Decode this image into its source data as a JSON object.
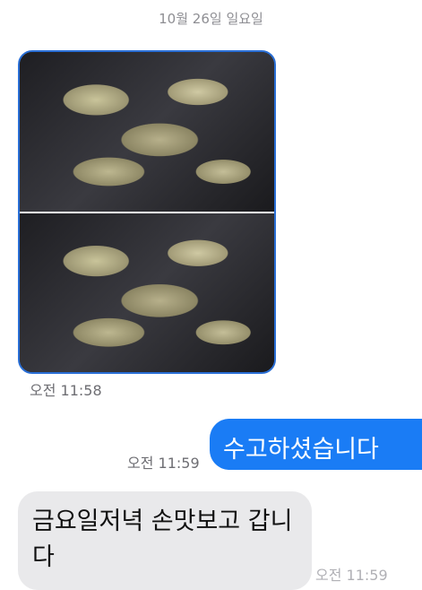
{
  "date_header": "10월 26일 일요일",
  "photo_message": {
    "timestamp": "오전 11:58"
  },
  "outgoing_message": {
    "text": "수고하셨습니다",
    "timestamp": "오전 11:59"
  },
  "incoming_message": {
    "text": "금요일저녁 손맛보고 갑니다",
    "timestamp": "오전 11:59"
  },
  "colors": {
    "outgoing_bubble": "#1a7cf5",
    "incoming_bubble": "#e9e9eb",
    "photo_border": "#2a6fd6"
  }
}
